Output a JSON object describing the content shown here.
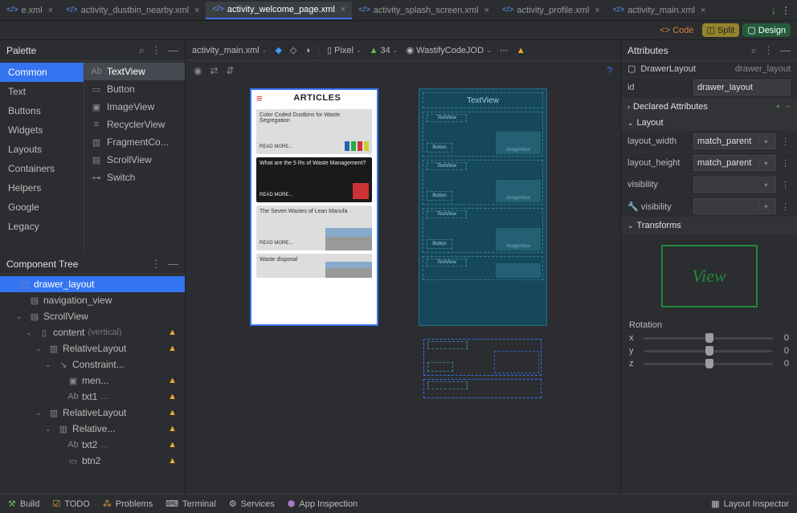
{
  "tabs": {
    "items": [
      {
        "label": "e.xml",
        "active": false,
        "truncated": true
      },
      {
        "label": "activity_dustbin_nearby.xml",
        "active": false
      },
      {
        "label": "activity_welcome_page.xml",
        "active": true
      },
      {
        "label": "activity_splash_screen.xml",
        "active": false
      },
      {
        "label": "activity_profile.xml",
        "active": false
      },
      {
        "label": "activity_main.xml",
        "active": false
      }
    ]
  },
  "viewModes": {
    "code": "Code",
    "split": "Split",
    "design": "Design"
  },
  "palette": {
    "title": "Palette",
    "categories": [
      "Common",
      "Text",
      "Buttons",
      "Widgets",
      "Layouts",
      "Containers",
      "Helpers",
      "Google",
      "Legacy"
    ],
    "activeCategory": "Common",
    "items": [
      {
        "icon": "Ab",
        "label": "TextView",
        "selected": true
      },
      {
        "icon": "▭",
        "label": "Button"
      },
      {
        "icon": "▣",
        "label": "ImageView"
      },
      {
        "icon": "≡",
        "label": "RecyclerView"
      },
      {
        "icon": "▥",
        "label": "FragmentCo..."
      },
      {
        "icon": "▤",
        "label": "ScrollView"
      },
      {
        "icon": "⊶",
        "label": "Switch"
      }
    ]
  },
  "componentTree": {
    "title": "Component Tree",
    "rows": [
      {
        "indent": 0,
        "arrow": "",
        "icon": "▢",
        "label": "drawer_layout",
        "warn": false,
        "selected": true
      },
      {
        "indent": 1,
        "arrow": "",
        "icon": "▤",
        "label": "navigation_view",
        "warn": false
      },
      {
        "indent": 1,
        "arrow": "⌄",
        "icon": "▤",
        "label": "ScrollView",
        "warn": false
      },
      {
        "indent": 2,
        "arrow": "⌄",
        "icon": "▯",
        "label": "content",
        "muted": "(vertical)",
        "warn": true
      },
      {
        "indent": 3,
        "arrow": "⌄",
        "icon": "▥",
        "label": "RelativeLayout",
        "warn": true
      },
      {
        "indent": 4,
        "arrow": "⌄",
        "icon": "↘",
        "label": "Constraint...",
        "warn": false
      },
      {
        "indent": 5,
        "arrow": "",
        "icon": "▣",
        "label": "men...",
        "warn": true
      },
      {
        "indent": 5,
        "arrow": "",
        "icon": "Ab",
        "label": "txt1",
        "muted": "...",
        "warn": true
      },
      {
        "indent": 3,
        "arrow": "⌄",
        "icon": "▥",
        "label": "RelativeLayout",
        "warn": true
      },
      {
        "indent": 4,
        "arrow": "⌄",
        "icon": "▥",
        "label": "Relative...",
        "warn": true
      },
      {
        "indent": 5,
        "arrow": "",
        "icon": "Ab",
        "label": "txt2",
        "muted": "...",
        "warn": true
      },
      {
        "indent": 5,
        "arrow": "",
        "icon": "▭",
        "label": "btn2",
        "warn": true
      }
    ]
  },
  "designToolbar": {
    "file": "activity_main.xml",
    "device": "Pixel",
    "api": "34",
    "theme": "WastifyCodeJOD"
  },
  "designPreview": {
    "title": "ARTICLES",
    "cards": [
      {
        "title": "Color Coded Dustbins for Waste Segregation",
        "readMore": "READ MORE...",
        "dark": false,
        "style": "bins"
      },
      {
        "title": "What are the 5 Rs of Waste Management?",
        "readMore": "READ MORE...",
        "dark": true,
        "style": "badge"
      },
      {
        "title": "The Seven Wastes of Lean Manufa",
        "readMore": "READ MORE...",
        "dark": false,
        "style": "thumb"
      },
      {
        "title": "Waste disposal",
        "readMore": "",
        "dark": false,
        "style": "thumb"
      }
    ],
    "blueprint": {
      "tvLabel": "TextView",
      "txtLabel": "TextView",
      "btnLabel": "Button",
      "imgLabel": "ImageView"
    }
  },
  "attributes": {
    "title": "Attributes",
    "componentType": "DrawerLayout",
    "componentId": "drawer_layout",
    "id": {
      "label": "id",
      "value": "drawer_layout"
    },
    "sections": {
      "declared": "Declared Attributes",
      "layout": "Layout",
      "transforms": "Transforms"
    },
    "layout_width": {
      "label": "layout_width",
      "value": "match_parent"
    },
    "layout_height": {
      "label": "layout_height",
      "value": "match_parent"
    },
    "visibility": {
      "label": "visibility",
      "value": ""
    },
    "tvisibility": {
      "label": "visibility",
      "value": ""
    },
    "viewPreview": "View",
    "rotation": {
      "label": "Rotation",
      "x": "x",
      "y": "y",
      "z": "z",
      "xval": "0",
      "yval": "0",
      "zval": "0"
    }
  },
  "statusBar": {
    "build": "Build",
    "todo": "TODO",
    "problems": "Problems",
    "terminal": "Terminal",
    "services": "Services",
    "appInspection": "App Inspection",
    "layoutInspector": "Layout Inspector"
  }
}
